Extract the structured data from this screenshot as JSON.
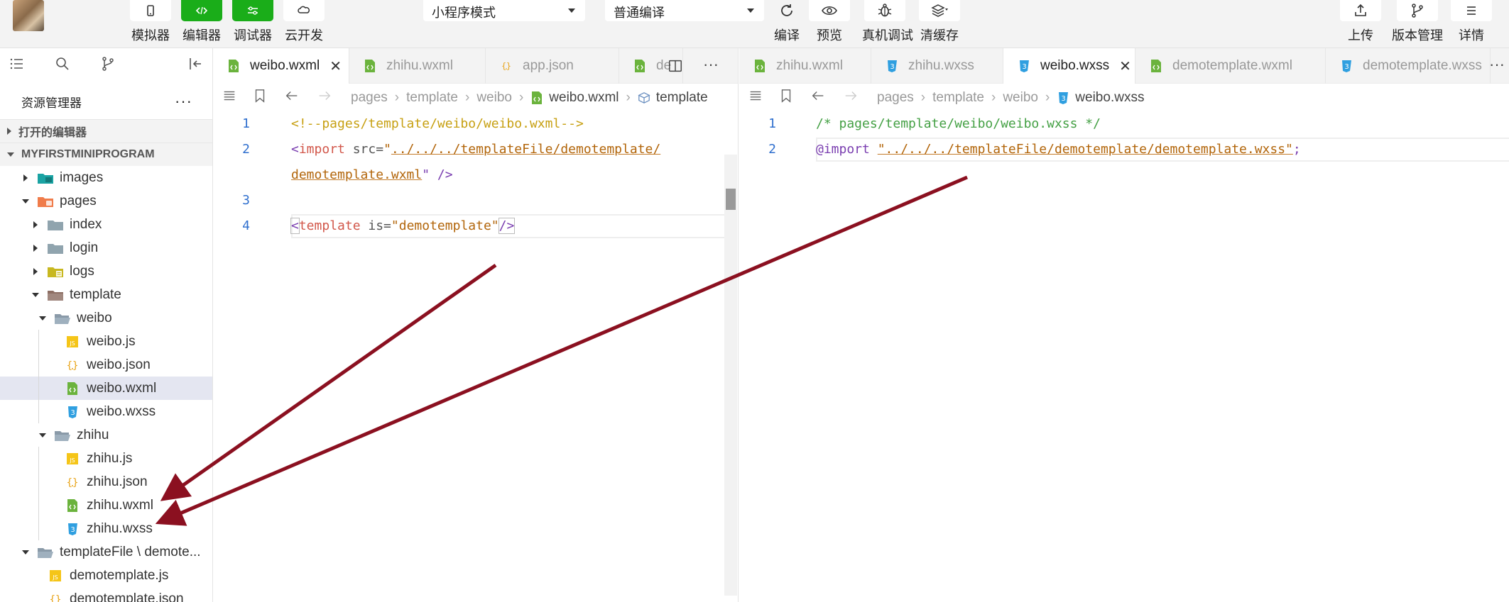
{
  "toolbar": {
    "simulator": "模拟器",
    "editor": "编辑器",
    "debugger": "调试器",
    "cloud": "云开发",
    "mode_select": "小程序模式",
    "compile_select": "普通编译",
    "compile": "编译",
    "preview": "预览",
    "remote_debug": "真机调试",
    "clear_cache": "清缓存",
    "upload": "上传",
    "version": "版本管理",
    "details": "详情",
    "accent_color": "#1aad19"
  },
  "sidebar": {
    "title": "资源管理器",
    "more": "···",
    "open_editors": "打开的编辑器",
    "project": "MYFIRSTMINIPROGRAM",
    "tree": [
      {
        "label": "images",
        "depth": 1,
        "arrow": "right",
        "icon": "images-folder-icon"
      },
      {
        "label": "pages",
        "depth": 1,
        "arrow": "down",
        "icon": "pages-folder-icon"
      },
      {
        "label": "index",
        "depth": 2,
        "arrow": "right",
        "icon": "folder-icon"
      },
      {
        "label": "login",
        "depth": 2,
        "arrow": "right",
        "icon": "folder-icon"
      },
      {
        "label": "logs",
        "depth": 2,
        "arrow": "right",
        "icon": "logs-folder-icon"
      },
      {
        "label": "template",
        "depth": 2,
        "arrow": "down",
        "icon": "template-folder-icon"
      },
      {
        "label": "weibo",
        "depth": 3,
        "arrow": "down",
        "icon": "open-folder-icon"
      },
      {
        "label": "weibo.js",
        "depth": 4,
        "arrow": "none",
        "icon": "js-file-icon"
      },
      {
        "label": "weibo.json",
        "depth": 4,
        "arrow": "none",
        "icon": "json-file-icon"
      },
      {
        "label": "weibo.wxml",
        "depth": 4,
        "arrow": "none",
        "icon": "wxml-file-icon",
        "selected": true
      },
      {
        "label": "weibo.wxss",
        "depth": 4,
        "arrow": "none",
        "icon": "wxss-file-icon"
      },
      {
        "label": "zhihu",
        "depth": 3,
        "arrow": "down",
        "icon": "open-folder-icon"
      },
      {
        "label": "zhihu.js",
        "depth": 4,
        "arrow": "none",
        "icon": "js-file-icon"
      },
      {
        "label": "zhihu.json",
        "depth": 4,
        "arrow": "none",
        "icon": "json-file-icon"
      },
      {
        "label": "zhihu.wxml",
        "depth": 4,
        "arrow": "none",
        "icon": "wxml-file-icon"
      },
      {
        "label": "zhihu.wxss",
        "depth": 4,
        "arrow": "none",
        "icon": "wxss-file-icon"
      },
      {
        "label": "templateFile \\ demote...",
        "depth": 1,
        "arrow": "down",
        "icon": "open-folder-icon"
      },
      {
        "label": "demotemplate.js",
        "depth": 2,
        "arrow": "none",
        "icon": "js-file-icon"
      },
      {
        "label": "demotemplate.json",
        "depth": 2,
        "arrow": "none",
        "icon": "json-file-icon"
      }
    ]
  },
  "left_editor": {
    "tabs": [
      {
        "label": "weibo.wxml",
        "icon": "wxml-file-icon",
        "active": true,
        "close": "✕"
      },
      {
        "label": "zhihu.wxml",
        "icon": "wxml-file-icon",
        "active": false
      },
      {
        "label": "app.json",
        "icon": "json-file-icon",
        "active": false
      },
      {
        "label": "de",
        "icon": "wxml-file-icon",
        "active": false
      }
    ],
    "more": "···",
    "breadcrumb": [
      "pages",
      "template",
      "weibo",
      "weibo.wxml",
      "template"
    ],
    "lines": {
      "n1": "1",
      "n2": "2",
      "n3": "3",
      "n4": "4",
      "l1": "<!--pages/template/weibo/weibo.wxml-->",
      "l2_open": "<",
      "l2_tag": "import",
      "l2_attr": " src=",
      "l2_q": "\"",
      "l2_path1": "../../../templateFile/demotemplate/",
      "l2_path2": "demotemplate.wxml",
      "l2_end": "\" />",
      "l4_open": "<",
      "l4_tag": "template",
      "l4_attr": " is=",
      "l4_val": "\"demotemplate\"",
      "l4_close": "/>"
    }
  },
  "right_editor": {
    "tabs": [
      {
        "label": "zhihu.wxml",
        "icon": "wxml-file-icon",
        "active": false
      },
      {
        "label": "zhihu.wxss",
        "icon": "wxss-file-icon",
        "active": false
      },
      {
        "label": "weibo.wxss",
        "icon": "wxss-file-icon",
        "active": true,
        "close": "✕"
      },
      {
        "label": "demotemplate.wxml",
        "icon": "wxml-file-icon",
        "active": false
      },
      {
        "label": "demotemplate.wxss",
        "icon": "wxss-file-icon",
        "active": false
      }
    ],
    "more": "···",
    "breadcrumb": [
      "pages",
      "template",
      "weibo",
      "weibo.wxss"
    ],
    "lines": {
      "n1": "1",
      "n2": "2",
      "l1": "/* pages/template/weibo/weibo.wxss */",
      "l2_at": "@import",
      "l2_space": " ",
      "l2_str": "\"../../../templateFile/demotemplate/demotemplate.wxss\"",
      "l2_semi": ";"
    }
  },
  "annotation_color": "#8b1020"
}
